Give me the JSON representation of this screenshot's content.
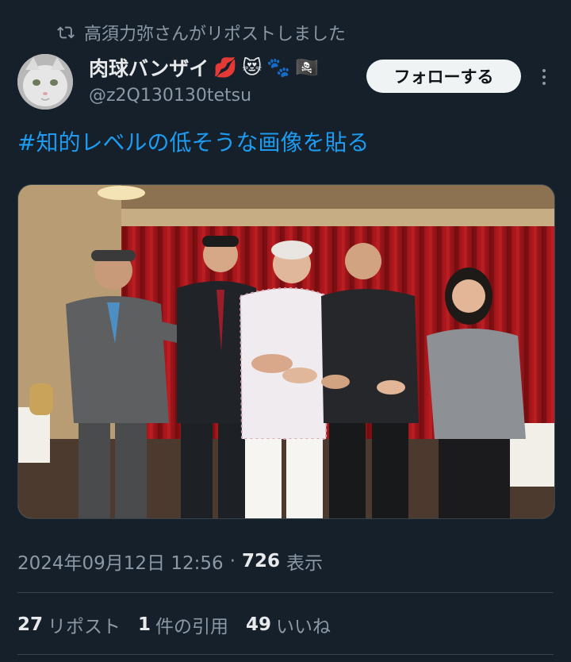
{
  "repost": {
    "text": "高須力弥さんがリポストしました",
    "icon": "repost-icon"
  },
  "author": {
    "display_name": "肉球バンザイ",
    "emojis": [
      "💋",
      "😻",
      "🐾",
      "🏴‍☠️"
    ],
    "handle": "@z2Q130130tetsu",
    "avatar_icon": "cat-avatar"
  },
  "follow_label": "フォローする",
  "more_icon": "more-icon",
  "tweet": {
    "text": "#知的レベルの低そうな画像を貼る"
  },
  "photo": {
    "subject": "five-people-posing-hands-together"
  },
  "meta": {
    "date": "2024年09月12日 12:56",
    "separator": "·",
    "views": "726",
    "views_label": "表示"
  },
  "stats": {
    "reposts": "27",
    "reposts_label": "リポスト",
    "quotes": "1",
    "quotes_label": "件の引用",
    "likes": "49",
    "likes_label": "いいね"
  },
  "colors": {
    "background": "#15202b",
    "accent": "#1d9bf0",
    "muted": "#8b98a5"
  }
}
